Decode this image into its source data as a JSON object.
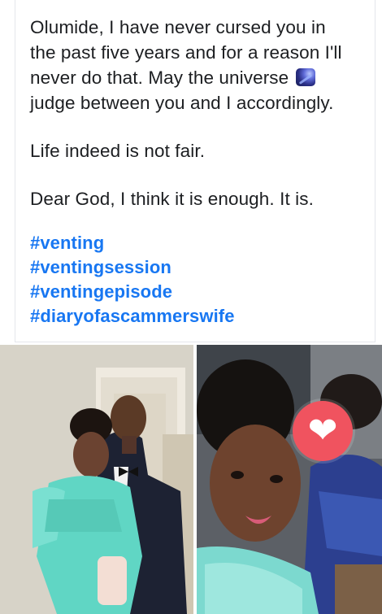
{
  "post": {
    "paragraphs": [
      {
        "lines": [
          "Olumide, I have never cursed you in",
          "the past five years and for a reason I'll",
          "never do that. May the universe",
          "judge between you and I accordingly."
        ],
        "emoji_after_line": 2,
        "emoji": "milky-way-emoji"
      },
      {
        "lines": [
          "Life indeed is not fair."
        ]
      },
      {
        "lines": [
          "Dear God, I think it is enough. It is."
        ]
      }
    ],
    "hashtags": [
      "#venting",
      "#ventingsession",
      "#ventingepisode",
      "#diaryofascammerswife"
    ],
    "colors": {
      "text": "#1c1e21",
      "hashtag": "#1877f2",
      "reaction_heart": "#f0535f"
    }
  },
  "photos": {
    "left": {
      "description_icon": "couple-photo"
    },
    "right": {
      "description_icon": "selfie-photo",
      "overlay_icon": "heart-reaction-icon"
    }
  }
}
